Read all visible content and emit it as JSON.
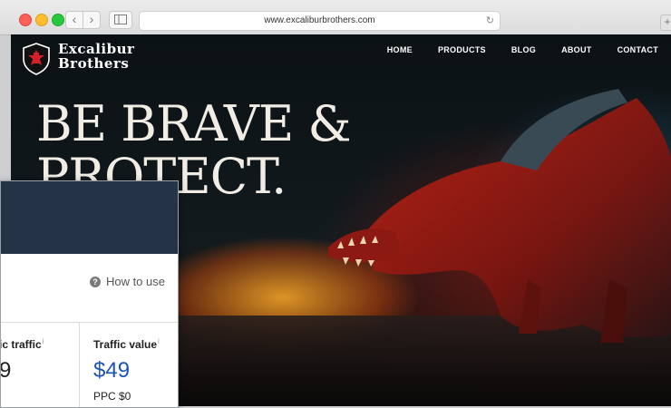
{
  "browser": {
    "url": "www.excaliburbrothers.com",
    "back_glyph": "‹",
    "forward_glyph": "›",
    "reload_glyph": "↻",
    "new_tab_glyph": "+"
  },
  "site": {
    "logo": {
      "line1": "Excalibur",
      "line2": "Brothers"
    },
    "nav": [
      "HOME",
      "PRODUCTS",
      "BLOG",
      "ABOUT",
      "CONTACT"
    ],
    "headline_line1": "BE BRAVE &",
    "headline_line2": "PROTECT."
  },
  "widget": {
    "how_to_use": "How to use",
    "help_glyph": "?",
    "organic_traffic_label": "ic traffic",
    "organic_traffic_value": "9",
    "traffic_value_label": "Traffic value",
    "traffic_value_value": "$49",
    "ppc_label": "PPC $0",
    "info_glyph": "i",
    "accent_color": "#1a55b5"
  }
}
